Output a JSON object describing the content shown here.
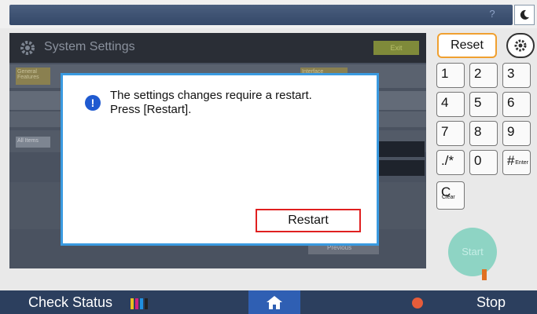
{
  "topbar": {
    "help_glyph": "?",
    "moon_icon": "moon-icon"
  },
  "settings": {
    "title": "System Settings",
    "exit_label": "Exit",
    "tab1_label": "General Features",
    "tab2_label": "Interface",
    "row_label": "All Items",
    "bottom_label": "Previous"
  },
  "keypad": {
    "reset_label": "Reset",
    "keys": [
      {
        "main": "1",
        "sub": ""
      },
      {
        "main": "2",
        "sub": ""
      },
      {
        "main": "3",
        "sub": ""
      },
      {
        "main": "4",
        "sub": ""
      },
      {
        "main": "5",
        "sub": ""
      },
      {
        "main": "6",
        "sub": ""
      },
      {
        "main": "7",
        "sub": ""
      },
      {
        "main": "8",
        "sub": ""
      },
      {
        "main": "9",
        "sub": ""
      },
      {
        "main": "./*",
        "sub": ""
      },
      {
        "main": "0",
        "sub": ""
      },
      {
        "main": "#",
        "sub": "Enter"
      },
      {
        "main": "C",
        "sub": "Clear"
      }
    ],
    "start_label": "Start"
  },
  "bottombar": {
    "check_status_label": "Check Status",
    "stop_label": "Stop",
    "toner_colors": [
      "#e8c020",
      "#d02080",
      "#2090e0",
      "#222222"
    ]
  },
  "dialog": {
    "line1": "The settings changes require a restart.",
    "line2": "Press [Restart].",
    "restart_label": "Restart",
    "icon_glyph": "!"
  },
  "colors": {
    "accent_orange": "#f0a030",
    "dialog_border": "#3a9ae0",
    "restart_border": "#e02020",
    "navy": "#2c3f5e"
  }
}
